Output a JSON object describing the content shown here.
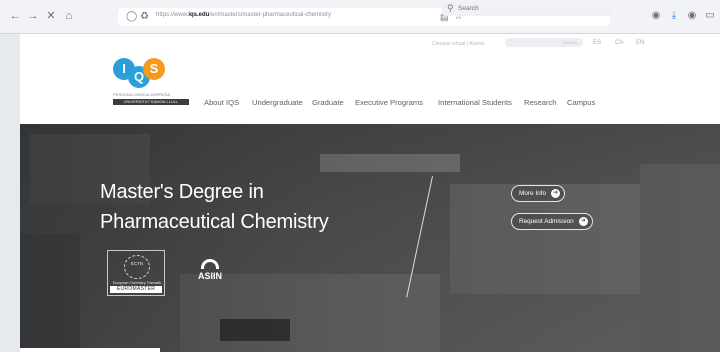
{
  "browser": {
    "url_prefix": "https://www.",
    "url_domain": "iqs.edu",
    "url_path": "/en/masters/master-pharmaceutical-chemistry",
    "search_placeholder": "Search"
  },
  "header": {
    "utility": {
      "links": "Campus virtual | Alumni",
      "search_label": "Search"
    },
    "languages": [
      "ES",
      "CA",
      "EN"
    ],
    "logo": {
      "letters": [
        "I",
        "Q",
        "S"
      ],
      "tagline": "PERSONA CIENCIA EMPRESA",
      "university": "UNIVERSITAT RAMON LLULL"
    },
    "menu": [
      "About IQS",
      "Undergraduate",
      "Graduate",
      "Executive Programs",
      "International Students",
      "Research",
      "Campus"
    ]
  },
  "hero": {
    "title_line1": "Master's Degree in",
    "title_line2": "Pharmaceutical Chemistry",
    "more_info": "More Info",
    "request_admission": "Request Admission",
    "ectn": {
      "label": "ECTN",
      "text": "European Chemistry Thematic Network Association",
      "badge": "EUROMASTER"
    },
    "asiin": "ASIIN"
  },
  "colors": {
    "accent_blue": "#2a9fd8",
    "accent_orange": "#f39a1f"
  }
}
